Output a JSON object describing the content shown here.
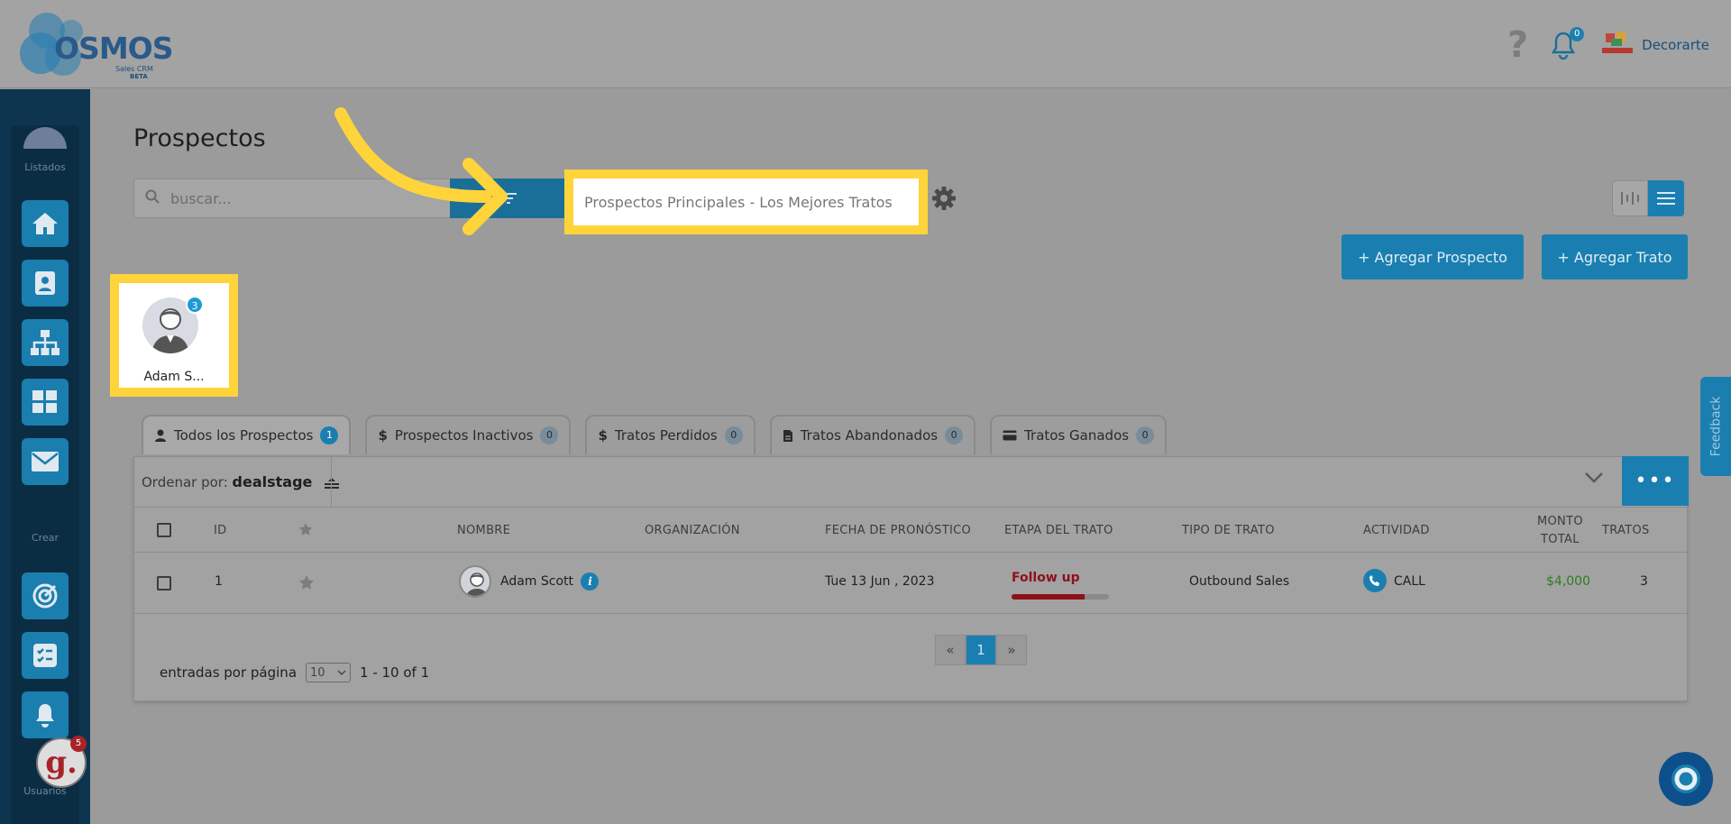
{
  "header": {
    "logo_text": "OSMOS",
    "logo_sub": "Sales CRM",
    "logo_beta": "BETA",
    "notifications_count": "0",
    "company_name": "Decorarte"
  },
  "sidebar": {
    "section_list": "Listados",
    "section_create": "Crear",
    "section_users": "Usuarios",
    "nav_icons": [
      "home-icon",
      "contacts-icon",
      "org-chart-icon",
      "grid-icon",
      "mail-icon"
    ],
    "create_icons": [
      "target-icon",
      "checklist-icon",
      "bell-plus-icon"
    ],
    "g_badge": "5",
    "g_letter": "g."
  },
  "main": {
    "title": "Prospectos",
    "search_placeholder": "buscar...",
    "view_name": "Prospectos Principales - Los Mejores Tratos",
    "add_prospect": "+ Agregar Prospecto",
    "add_deal": "+ Agregar Trato"
  },
  "user_card": {
    "name": "Adam S...",
    "badge": "3"
  },
  "tabs": [
    {
      "label": "Todos los Prospectos",
      "count": "1",
      "icon": "user-icon"
    },
    {
      "label": "Prospectos Inactivos",
      "count": "0",
      "icon": "dollar-icon"
    },
    {
      "label": "Tratos Perdidos",
      "count": "0",
      "icon": "dollar-icon"
    },
    {
      "label": "Tratos Abandonados",
      "count": "0",
      "icon": "file-icon"
    },
    {
      "label": "Tratos Ganados",
      "count": "0",
      "icon": "card-icon"
    }
  ],
  "sort": {
    "label": "Ordenar por:",
    "value": "dealstage"
  },
  "table": {
    "headers": {
      "id": "ID",
      "name": "NOMBRE",
      "org": "ORGANIZACIÓN",
      "forecast": "FECHA DE PRONÓSTICO",
      "stage": "ETAPA DEL TRATO",
      "type": "TIPO DE TRATO",
      "activity": "ACTIVIDAD",
      "total_1": "MONTO",
      "total_2": "TOTAL",
      "deals": "TRATOS"
    },
    "rows": [
      {
        "id": "1",
        "name": "Adam Scott",
        "org": "",
        "forecast": "Tue 13 Jun , 2023",
        "stage": "Follow up",
        "stage_progress": 0.75,
        "type": "Outbound Sales",
        "activity": "CALL",
        "total": "$4,000",
        "deals": "3"
      }
    ]
  },
  "pagination": {
    "per_page_label": "entradas por página",
    "per_page": "10",
    "range": "1 - 10 of 1",
    "prev": "«",
    "current": "1",
    "next": "»"
  },
  "feedback_label": "Feedback",
  "colors": {
    "accent": "#1a7fb0",
    "highlight": "#ffd43b",
    "stage": "#8e1018",
    "amount": "#2f7d1f"
  }
}
